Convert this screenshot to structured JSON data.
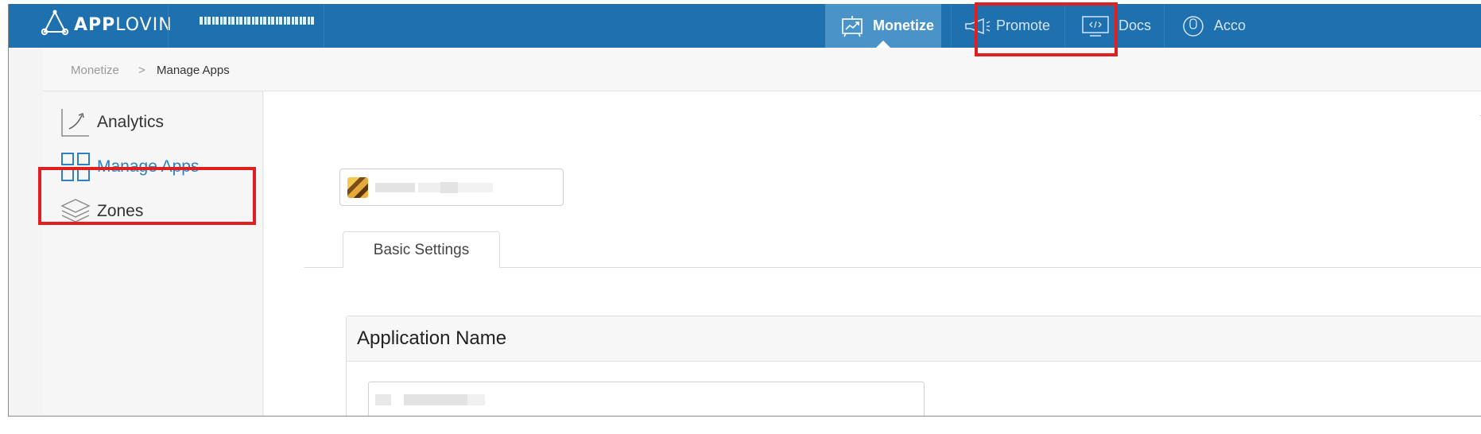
{
  "brand": {
    "bold": "APP",
    "light": "LOVIN",
    "logo_icon": "applovin-triangle-logo"
  },
  "topnav": {
    "items": [
      {
        "label": "Monetize",
        "icon": "monetize-chart-icon",
        "active": true
      },
      {
        "label": "Promote",
        "icon": "megaphone-icon",
        "active": false
      },
      {
        "label": "Docs",
        "icon": "code-icon",
        "active": false
      },
      {
        "label": "Acco",
        "icon": "account-user-icon",
        "active": false
      }
    ]
  },
  "breadcrumb": {
    "root": "Monetize",
    "separator": ">",
    "current": "Manage Apps"
  },
  "sidebar": {
    "items": [
      {
        "label": "Analytics",
        "icon": "analytics-chart-icon"
      },
      {
        "label": "Manage Apps",
        "icon": "grid-apps-icon",
        "active": true
      },
      {
        "label": "Zones",
        "icon": "layers-icon"
      }
    ]
  },
  "main": {
    "tabs": [
      {
        "label": "Basic Settings"
      }
    ],
    "panel": {
      "title": "Application Name"
    }
  },
  "colors": {
    "topbar": "#1f70ae",
    "active_nav": "#4a93c8",
    "accent": "#2e7fc6",
    "highlight": "#e02020"
  }
}
